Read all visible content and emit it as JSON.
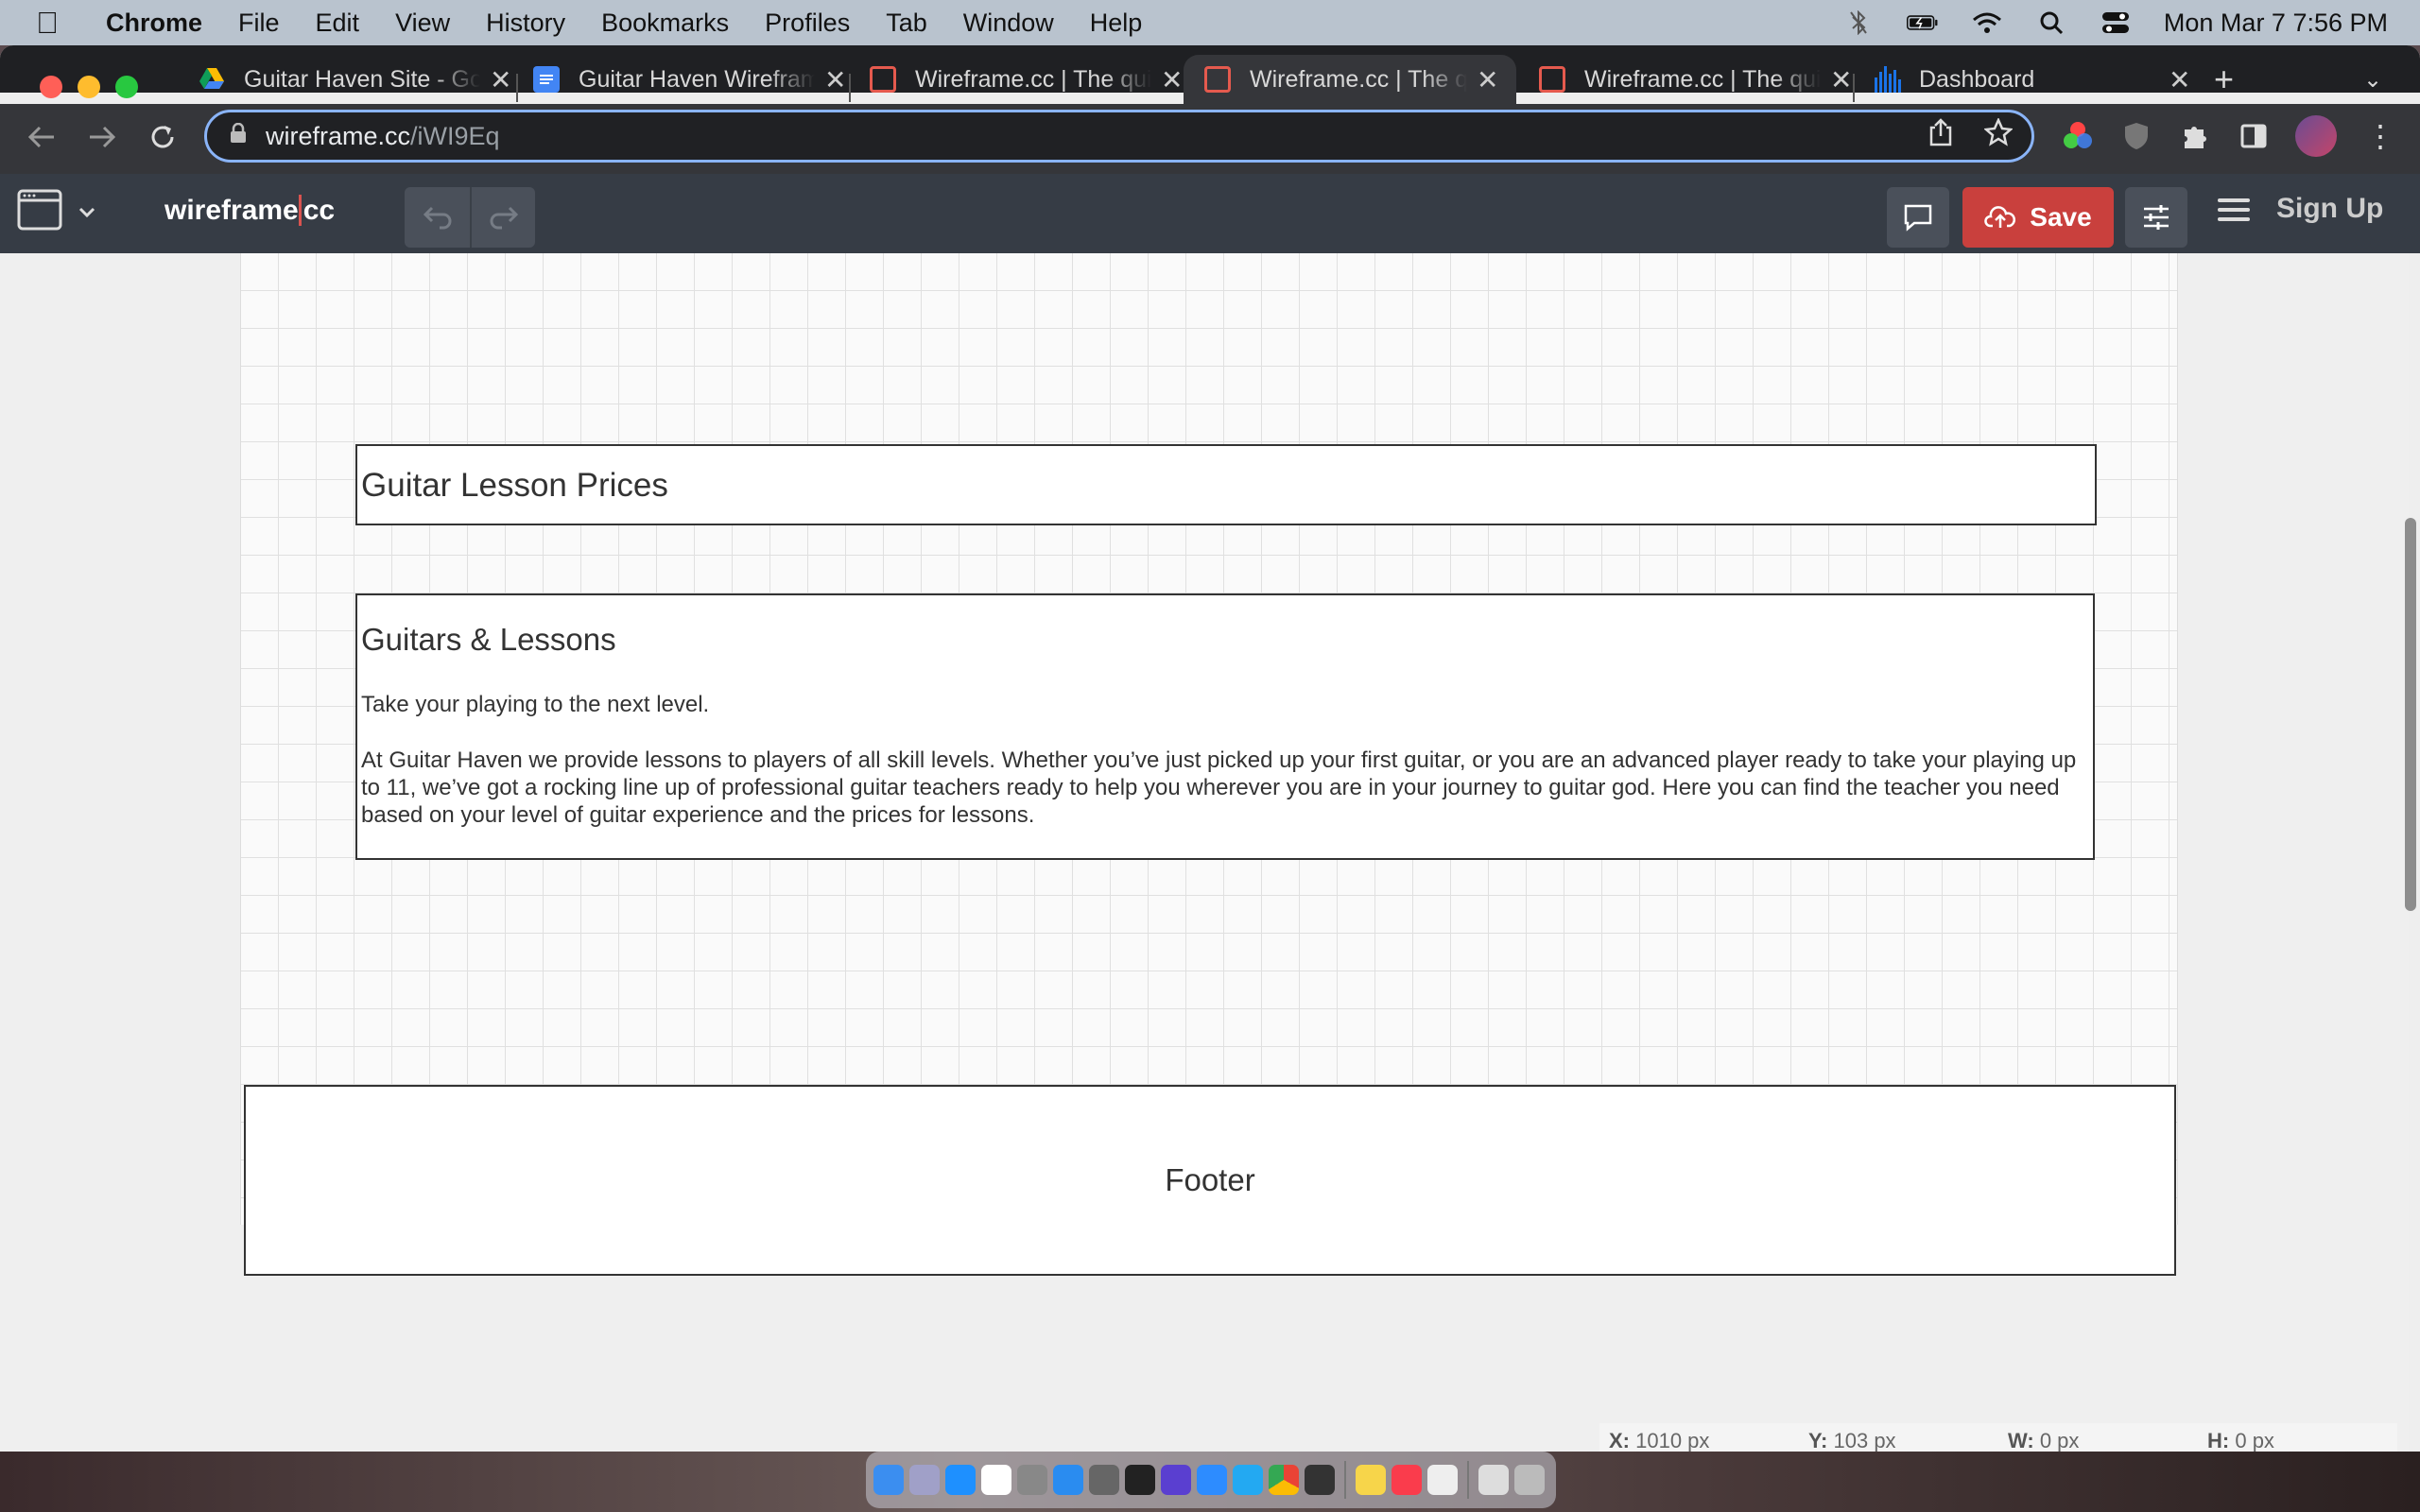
{
  "menubar": {
    "app_name": "Chrome",
    "items": [
      "File",
      "Edit",
      "View",
      "History",
      "Bookmarks",
      "Profiles",
      "Tab",
      "Window",
      "Help"
    ],
    "clock": "Mon Mar 7  7:56 PM"
  },
  "tabs": [
    {
      "title": "Guitar Haven Site - Google Drive",
      "favicon": "google-drive-icon",
      "color": "#fbbc04"
    },
    {
      "title": "Guitar Haven Wireframe - Google Docs",
      "favicon": "google-docs-icon",
      "color": "#4285f4"
    },
    {
      "title": "Wireframe.cc | The quickest wireframe tool",
      "favicon": "wireframe-cc-icon",
      "color": "#e55a4e"
    },
    {
      "title": "Wireframe.cc | The quickest wireframe tool",
      "favicon": "wireframe-cc-icon",
      "color": "#e55a4e"
    },
    {
      "title": "Wireframe.cc | The quickest wireframe tool",
      "favicon": "wireframe-cc-icon",
      "color": "#e55a4e"
    },
    {
      "title": "Dashboard",
      "favicon": "dashboard-bars-icon",
      "color": "#1a73e8"
    }
  ],
  "active_tab_index": 3,
  "address_bar": {
    "host": "wireframe.cc",
    "path": "/iWI9Eq"
  },
  "app": {
    "logo_main": "wireframe",
    "logo_suffix": "cc",
    "save_label": "Save",
    "signup_label": "Sign Up",
    "accent_color": "#c9403d"
  },
  "wireframe": {
    "heading": "Guitar Lesson Prices",
    "section_title": "Guitars & Lessons",
    "tagline": "Take your playing to the next level.",
    "body": "At Guitar Haven we provide lessons to players of all skill levels. Whether you’ve just picked up your first guitar, or you are an advanced player ready to take your playing up to 11, we’ve got a rocking line up of professional guitar teachers ready to help you wherever you are in your journey to guitar god. Here you can find the teacher you need based on your level of guitar experience and the prices for lessons.",
    "footer": "Footer"
  },
  "status_bar": {
    "x_label": "X:",
    "x_value": "1010 px",
    "y_label": "Y:",
    "y_value": "103 px",
    "w_label": "W:",
    "w_value": "0 px",
    "h_label": "H:",
    "h_value": "0 px"
  }
}
